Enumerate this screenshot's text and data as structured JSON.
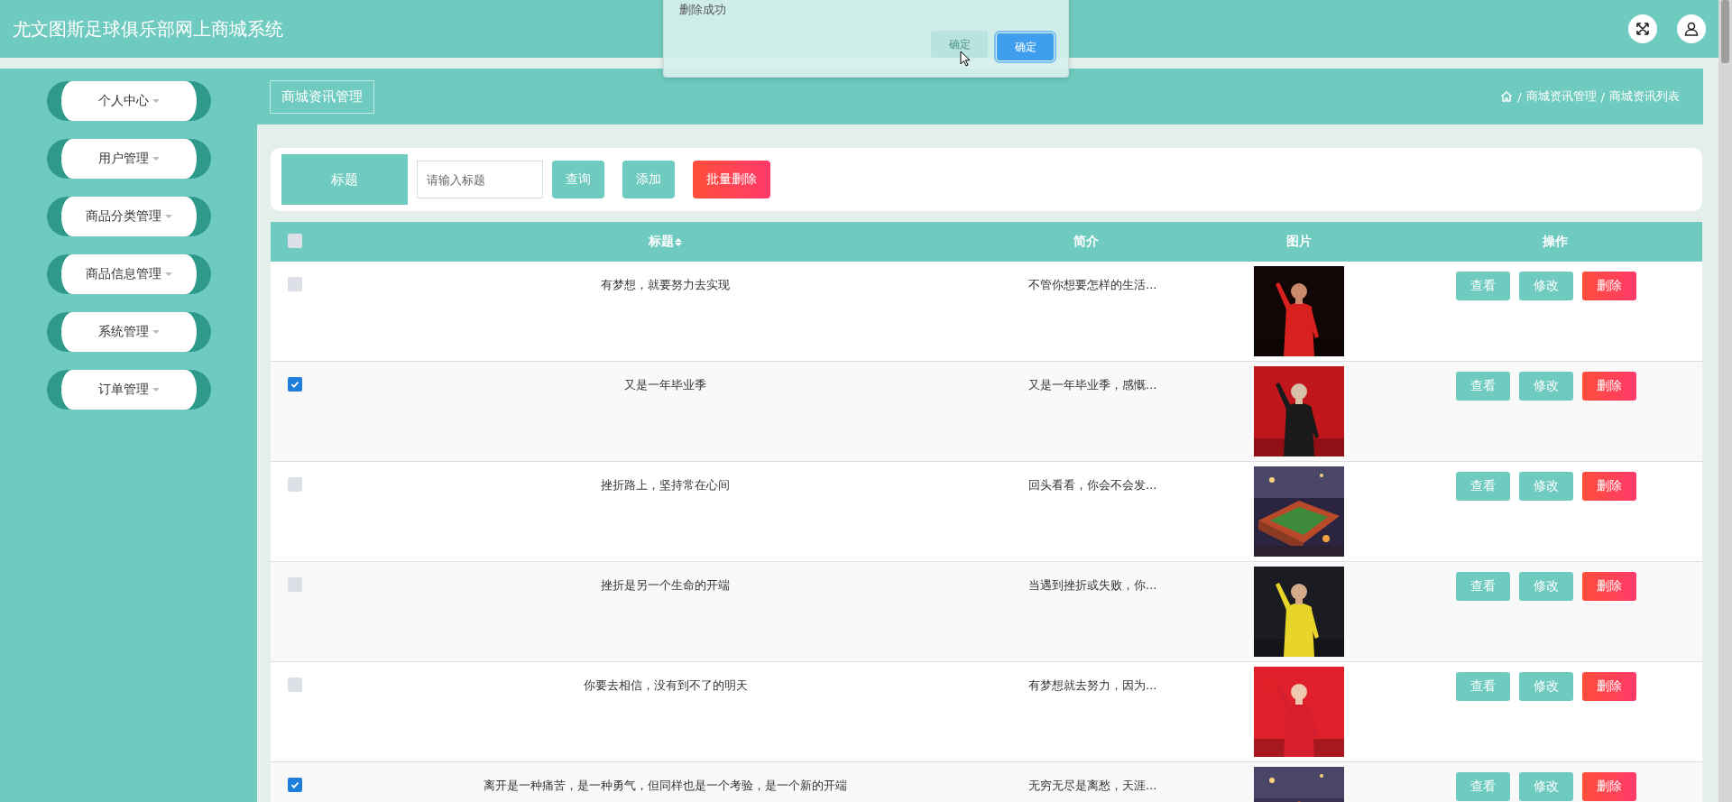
{
  "header": {
    "title": "尤文图斯足球俱乐部网上商城系统"
  },
  "sidebar": {
    "items": [
      {
        "label": "个人中心"
      },
      {
        "label": "用户管理"
      },
      {
        "label": "商品分类管理"
      },
      {
        "label": "商品信息管理"
      },
      {
        "label": "系统管理"
      },
      {
        "label": "订单管理"
      }
    ]
  },
  "breadcrumb": {
    "page_title": "商城资讯管理",
    "path": [
      {
        "separator": "/",
        "label": "商城资讯管理"
      },
      {
        "separator": "/",
        "label": "商城资讯列表"
      }
    ]
  },
  "search": {
    "label": "标题",
    "placeholder": "请输入标题",
    "buttons": [
      {
        "label": "查询",
        "kind": "primary"
      },
      {
        "label": "添加",
        "kind": "primary"
      },
      {
        "label": "批量删除",
        "kind": "danger"
      }
    ]
  },
  "table": {
    "select_all_checked": false,
    "columns": [
      {
        "label": "标题",
        "sortable": true
      },
      {
        "label": "简介",
        "sortable": false
      },
      {
        "label": "图片",
        "sortable": false
      },
      {
        "label": "操作",
        "sortable": false
      }
    ],
    "rows": [
      {
        "checked": false,
        "title": "有梦想，就要努力去实现",
        "intro": "不管你想要怎样的生活...",
        "actions": [
          {
            "label": "查看",
            "kind": "primary"
          },
          {
            "label": "修改",
            "kind": "primary"
          },
          {
            "label": "删除",
            "kind": "danger"
          }
        ]
      },
      {
        "checked": true,
        "title": "又是一年毕业季",
        "intro": "又是一年毕业季，感慨...",
        "actions": [
          {
            "label": "查看",
            "kind": "primary"
          },
          {
            "label": "修改",
            "kind": "primary"
          },
          {
            "label": "删除",
            "kind": "danger"
          }
        ]
      },
      {
        "checked": false,
        "title": "挫折路上，坚持常在心间",
        "intro": "回头看看，你会不会发...",
        "actions": [
          {
            "label": "查看",
            "kind": "primary"
          },
          {
            "label": "修改",
            "kind": "primary"
          },
          {
            "label": "删除",
            "kind": "danger"
          }
        ]
      },
      {
        "checked": false,
        "title": "挫折是另一个生命的开端",
        "intro": "当遇到挫折或失败，你...",
        "actions": [
          {
            "label": "查看",
            "kind": "primary"
          },
          {
            "label": "修改",
            "kind": "primary"
          },
          {
            "label": "删除",
            "kind": "danger"
          }
        ]
      },
      {
        "checked": false,
        "title": "你要去相信，没有到不了的明天",
        "intro": "有梦想就去努力，因为...",
        "actions": [
          {
            "label": "查看",
            "kind": "primary"
          },
          {
            "label": "修改",
            "kind": "primary"
          },
          {
            "label": "删除",
            "kind": "danger"
          }
        ]
      },
      {
        "checked": true,
        "title": "离开是一种痛苦，是一种勇气，但同样也是一个考验，是一个新的开端",
        "intro": "无穷无尽是离愁，天涯...",
        "actions": [
          {
            "label": "查看",
            "kind": "primary"
          },
          {
            "label": "修改",
            "kind": "primary"
          },
          {
            "label": "删除",
            "kind": "danger"
          }
        ]
      }
    ]
  },
  "dialog": {
    "message": "删除成功",
    "buttons": [
      {
        "label": "确定",
        "kind": "ghost"
      },
      {
        "label": "确定",
        "kind": "primary"
      }
    ]
  }
}
